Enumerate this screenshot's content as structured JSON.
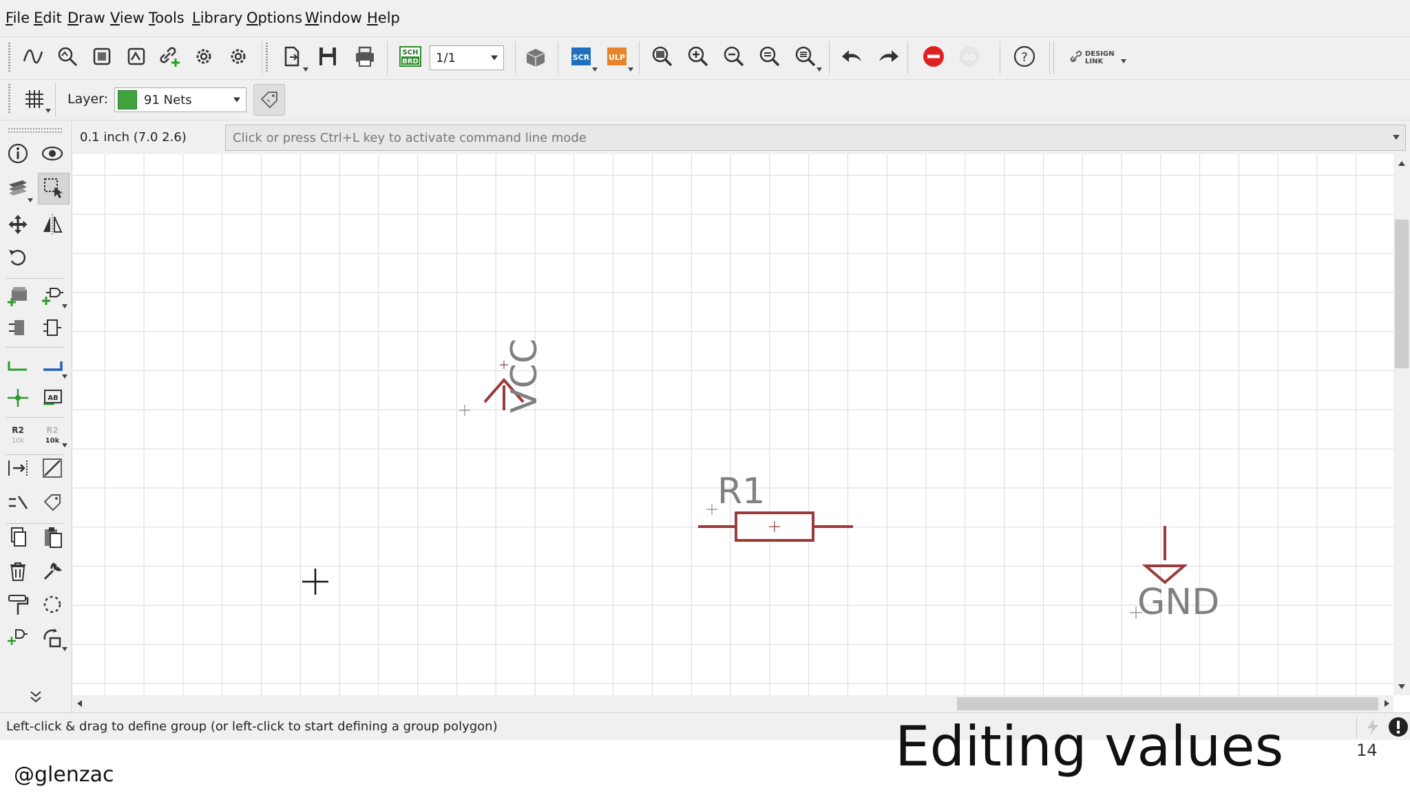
{
  "menu": {
    "items": [
      "File",
      "Edit",
      "Draw",
      "View",
      "Tools",
      "Library",
      "Options",
      "Window",
      "Help"
    ]
  },
  "toolbar": {
    "sheet_select": "1/1",
    "scr_label": "SCR",
    "ulp_label": "ULP",
    "sch_brd_label_top": "SCH",
    "sch_brd_label_bottom": "BRD",
    "design_link_top": "DESIGN",
    "design_link_bottom": "LINK"
  },
  "param_bar": {
    "layer_label": "Layer:",
    "layer_value": "91 Nets",
    "layer_color": "#3ea33e"
  },
  "coord": {
    "readout": "0.1 inch (7.0 2.6)",
    "command_placeholder": "Click or press Ctrl+L key to activate command line mode"
  },
  "schematic": {
    "vcc_label": "VCC",
    "r1_label": "R1",
    "gnd_label": "GND",
    "symbol_color": "#9a3a3a",
    "label_color": "#808080"
  },
  "left_tools": {
    "value_label_top": "R2",
    "value_label_bottom": "10k",
    "value_label2_top": "R2",
    "value_label2_bottom": "10k",
    "ab_label": "AB"
  },
  "status": {
    "hint": "Left-click & drag to define group (or left-click to start defining a group polygon)"
  },
  "slide": {
    "title": "Editing values",
    "page_number": "14",
    "handle": "@glenzac"
  }
}
